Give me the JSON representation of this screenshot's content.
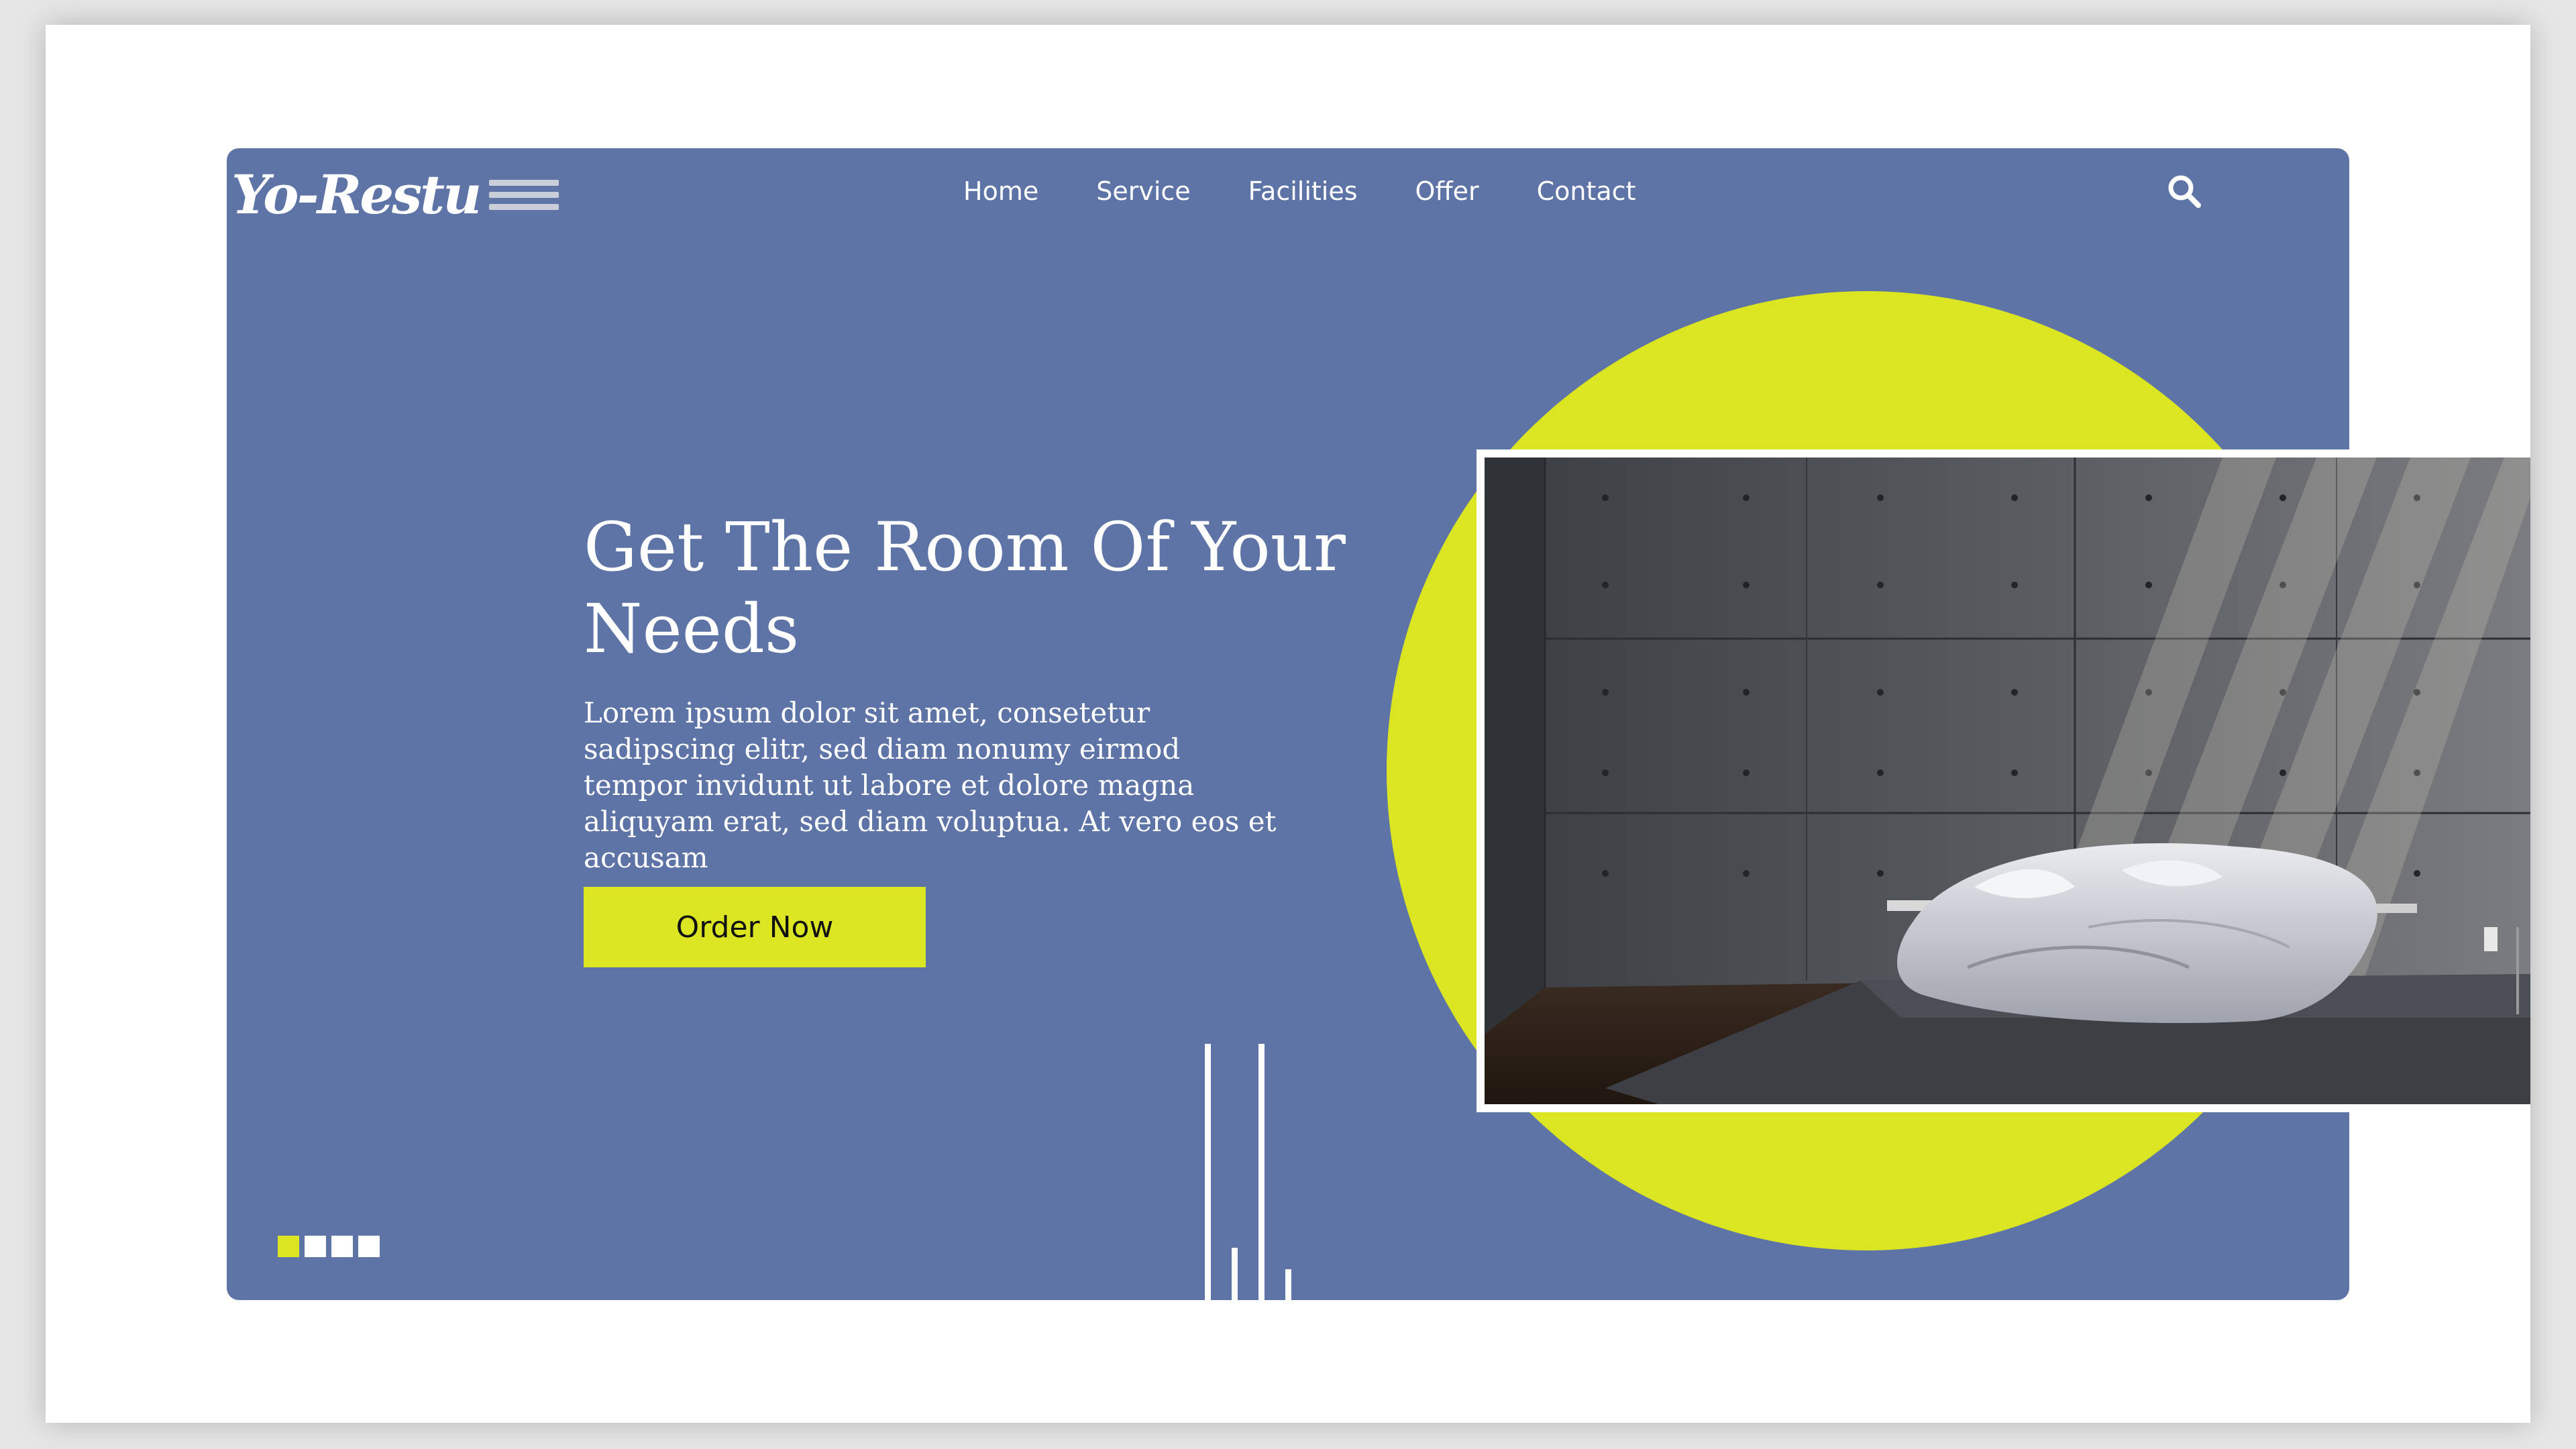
{
  "brand": {
    "logo_text": "Yo-Restu"
  },
  "nav": {
    "items": [
      {
        "label": "Home"
      },
      {
        "label": "Service"
      },
      {
        "label": "Facilities"
      },
      {
        "label": "Offer"
      },
      {
        "label": "Contact"
      }
    ],
    "search_icon": "search-icon",
    "menu_icon": "hamburger-icon"
  },
  "hero": {
    "title": "Get The Room Of Your Needs",
    "text": "Lorem ipsum dolor sit amet, consetetur sadipscing elitr, sed diam nonumy eirmod tempor invidunt ut labore et dolore magna aliquyam erat, sed diam voluptua. At vero eos et accusam",
    "cta_label": "Order Now",
    "image_subject": "modern bedroom with concrete wall and bed"
  },
  "slider": {
    "total": 4,
    "active_index": 0
  },
  "colors": {
    "background": "#5e74a6",
    "accent": "#dbe521",
    "text": "#ffffff",
    "button_text": "#111111"
  }
}
